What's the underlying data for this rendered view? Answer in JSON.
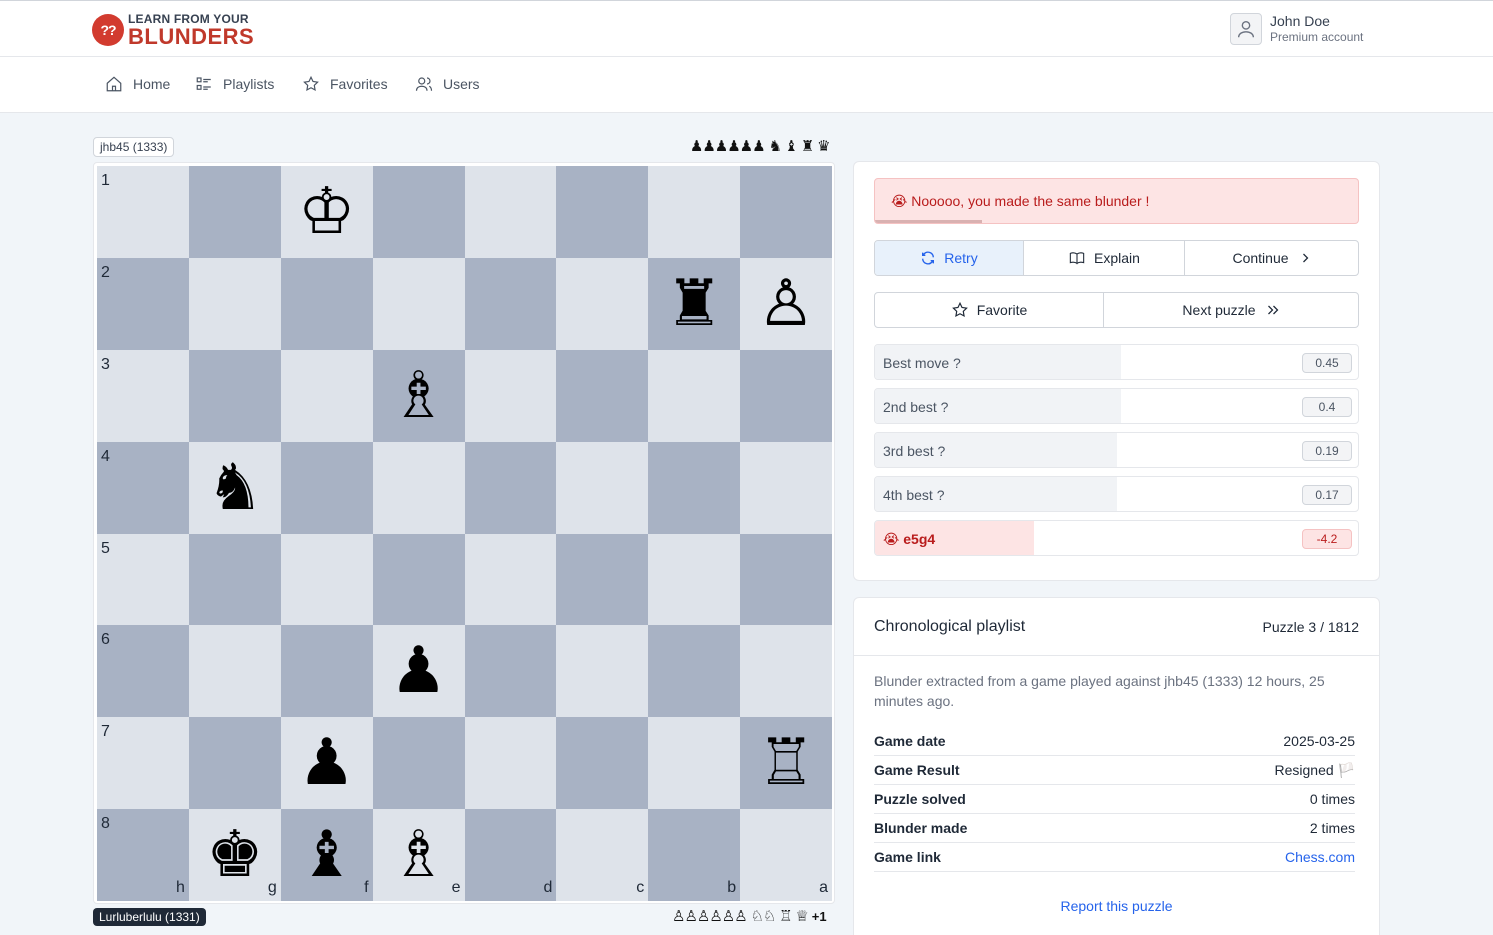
{
  "header": {
    "logo_top": "LEARN FROM YOUR",
    "logo_bottom": "BLUNDERS",
    "logo_mark": "??",
    "user_name": "John Doe",
    "user_type": "Premium account"
  },
  "nav": [
    {
      "label": "Home",
      "icon": "home-icon"
    },
    {
      "label": "Playlists",
      "icon": "playlist-icon"
    },
    {
      "label": "Favorites",
      "icon": "star-icon"
    },
    {
      "label": "Users",
      "icon": "users-icon"
    }
  ],
  "board": {
    "top_player": "jhb45 (1333)",
    "bottom_player": "Lurluberlulu (1331)",
    "top_captured": "♟♟♟♟♟♟ ♞ ♝ ♜ ♛",
    "bottom_captured": "♙♙♙♙♙♙ ♘♘ ♖ ♕",
    "bottom_advantage": "+1",
    "ranks": [
      "1",
      "2",
      "3",
      "4",
      "5",
      "6",
      "7",
      "8"
    ],
    "files": [
      "h",
      "g",
      "f",
      "e",
      "d",
      "c",
      "b",
      "a"
    ],
    "pieces": {
      "0-2": "♔",
      "1-6": "♜",
      "1-7": "♙",
      "2-3": "♗",
      "3-1": "♞",
      "5-3": "♟",
      "6-2": "♟",
      "6-7": "♖",
      "7-1": "♚",
      "7-2": "♝",
      "7-3": "♗"
    },
    "colors": {
      "light": "#dee3ea",
      "dark": "#a8b2c4"
    }
  },
  "feedback": {
    "message": "😭 Nooooo, you made the same blunder !",
    "retry": "Retry",
    "explain": "Explain",
    "continue": "Continue",
    "favorite": "Favorite",
    "next": "Next puzzle"
  },
  "moves": [
    {
      "label": "Best move ?",
      "score": "0.45",
      "fill_percent": 51
    },
    {
      "label": "2nd best ?",
      "score": "0.4",
      "fill_percent": 51
    },
    {
      "label": "3rd best ?",
      "score": "0.19",
      "fill_percent": 50
    },
    {
      "label": "4th best ?",
      "score": "0.17",
      "fill_percent": 50
    },
    {
      "label": "😭 e5g4",
      "score": "-4.2",
      "fill_percent": 33,
      "bad": true
    }
  ],
  "playlist": {
    "title": "Chronological playlist",
    "count": "Puzzle 3 / 1812",
    "description": "Blunder extracted from a game played against jhb45 (1333) 12 hours, 25 minutes ago.",
    "rows": [
      {
        "key": "Game date",
        "value": "2025-03-25"
      },
      {
        "key": "Game Result",
        "value": "Resigned 🏳️"
      },
      {
        "key": "Puzzle solved",
        "value": "0 times"
      },
      {
        "key": "Blunder made",
        "value": "2 times"
      },
      {
        "key": "Game link",
        "value": "Chess.com",
        "link": true
      }
    ],
    "report": "Report this puzzle"
  }
}
